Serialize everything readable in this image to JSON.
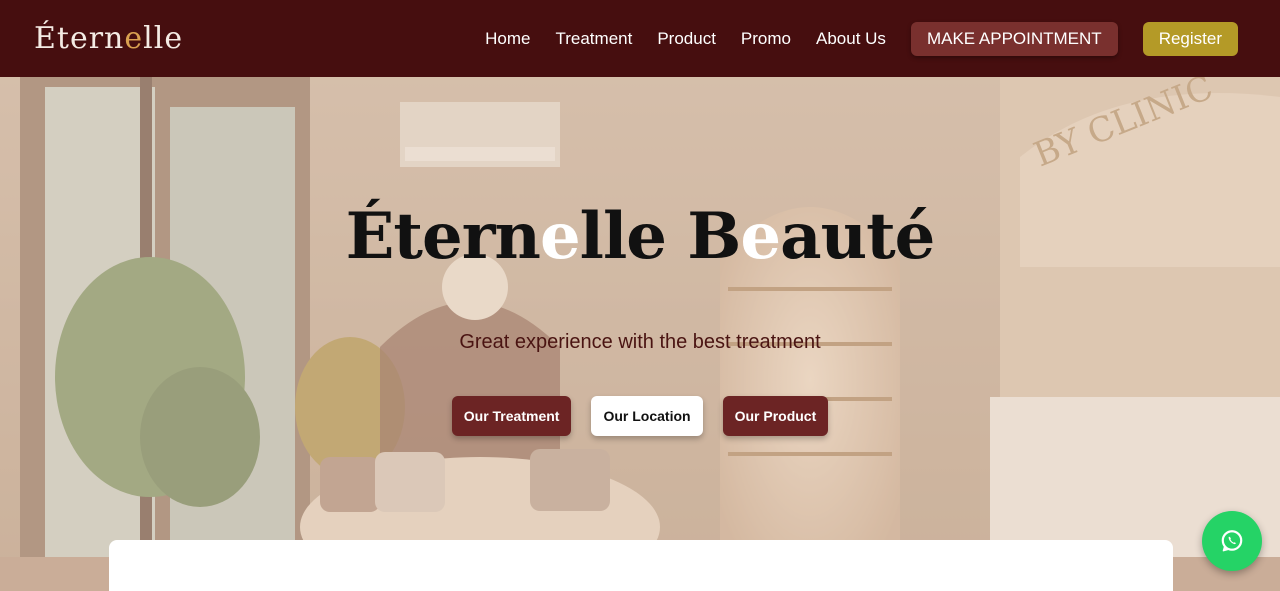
{
  "header": {
    "logo_parts": [
      "Étern",
      "e",
      "lle"
    ],
    "nav": [
      "Home",
      "Treatment",
      "Product",
      "Promo",
      "About Us"
    ],
    "appointment_label": "MAKE APPOINTMENT",
    "register_label": "Register"
  },
  "hero": {
    "title_parts": [
      "Étern",
      "e",
      "lle B",
      "e",
      "auté"
    ],
    "subtitle": "Great experience with the best treatment",
    "buttons": [
      "Our Treatment",
      "Our Location",
      "Our Product"
    ],
    "wall_sign": "BY CLINIC"
  },
  "floating": {
    "icon": "whatsapp-icon"
  },
  "colors": {
    "header_bg": "#460e0f",
    "logo_accent": "#d9a050",
    "appointment_bg": "#79302e",
    "register_bg": "#b49a27",
    "hero_button_bg": "#6c2424",
    "whatsapp_green": "#25d366"
  }
}
